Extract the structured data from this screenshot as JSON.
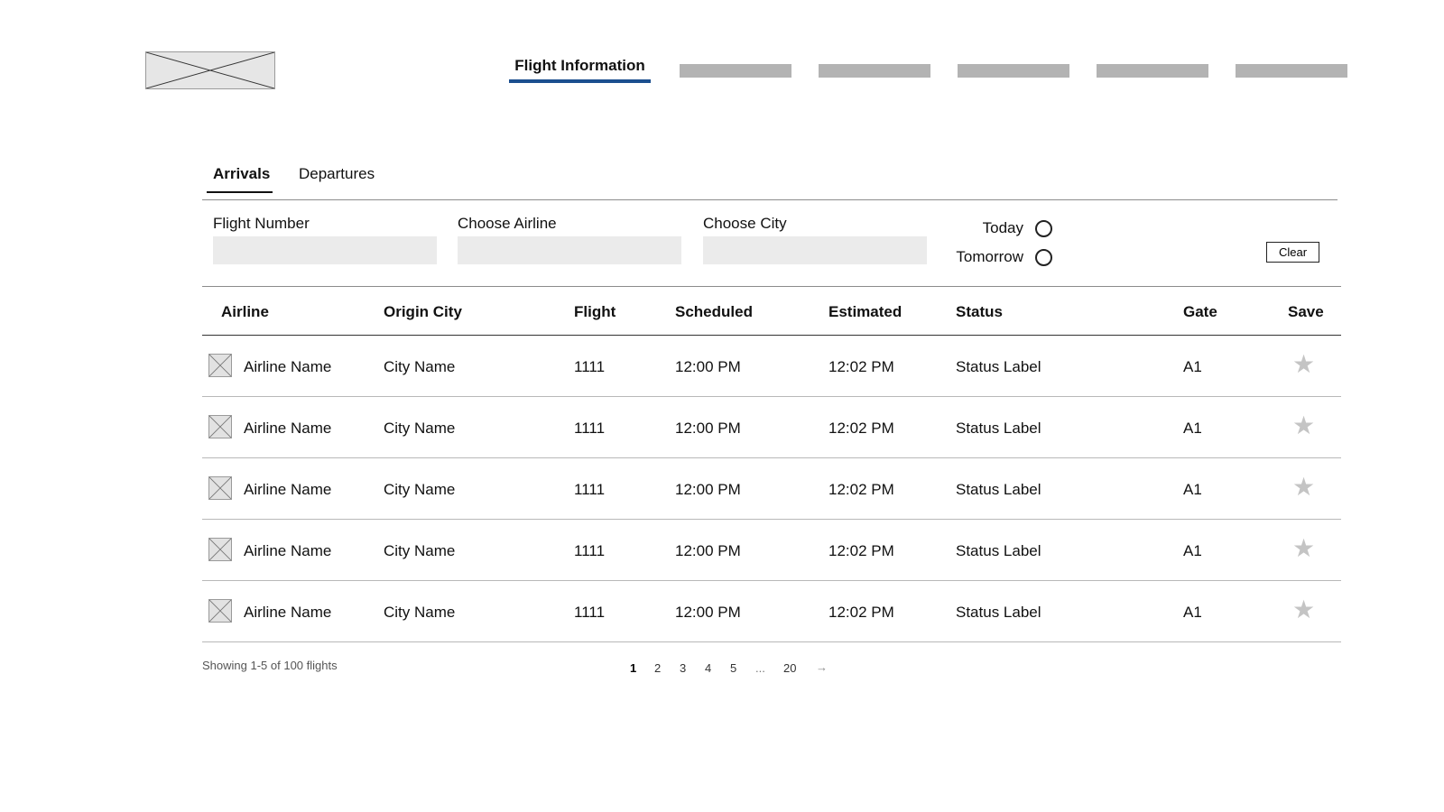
{
  "header": {
    "logo_icon": "image-placeholder-icon",
    "nav": {
      "active_label": "Flight Information",
      "placeholder_count": 5
    },
    "accent_color": "#1b4f8f"
  },
  "tabs": [
    {
      "label": "Arrivals",
      "active": true
    },
    {
      "label": "Departures",
      "active": false
    }
  ],
  "filters": {
    "flight_number": {
      "label": "Flight Number",
      "value": "",
      "placeholder": ""
    },
    "airline": {
      "label": "Choose Airline",
      "value": "",
      "placeholder": ""
    },
    "city": {
      "label": "Choose City",
      "value": "",
      "placeholder": ""
    },
    "date_options": [
      {
        "label": "Today",
        "selected": false
      },
      {
        "label": "Tomorrow",
        "selected": false
      }
    ],
    "clear_label": "Clear"
  },
  "table": {
    "columns": [
      "Airline",
      "Origin City",
      "Flight",
      "Scheduled",
      "Estimated",
      "Status",
      "Gate",
      "Save"
    ],
    "rows": [
      {
        "airline": "Airline Name",
        "origin": "City Name",
        "flight": "1111",
        "scheduled": "12:00 PM",
        "estimated": "12:02 PM",
        "status": "Status Label",
        "gate": "A1",
        "saved": false
      },
      {
        "airline": "Airline Name",
        "origin": "City Name",
        "flight": "1111",
        "scheduled": "12:00 PM",
        "estimated": "12:02 PM",
        "status": "Status Label",
        "gate": "A1",
        "saved": false
      },
      {
        "airline": "Airline Name",
        "origin": "City Name",
        "flight": "1111",
        "scheduled": "12:00 PM",
        "estimated": "12:02 PM",
        "status": "Status Label",
        "gate": "A1",
        "saved": false
      },
      {
        "airline": "Airline Name",
        "origin": "City Name",
        "flight": "1111",
        "scheduled": "12:00 PM",
        "estimated": "12:02 PM",
        "status": "Status Label",
        "gate": "A1",
        "saved": false
      },
      {
        "airline": "Airline Name",
        "origin": "City Name",
        "flight": "1111",
        "scheduled": "12:00 PM",
        "estimated": "12:02 PM",
        "status": "Status Label",
        "gate": "A1",
        "saved": false
      }
    ],
    "airline_icon": "image-placeholder-icon",
    "save_icon": "star-icon"
  },
  "footer": {
    "showing_text": "Showing 1-5 of 100 flights",
    "pages": [
      "1",
      "2",
      "3",
      "4",
      "5"
    ],
    "ellipsis": "...",
    "last_page": "20",
    "current_page": "1",
    "next_glyph": "→"
  }
}
